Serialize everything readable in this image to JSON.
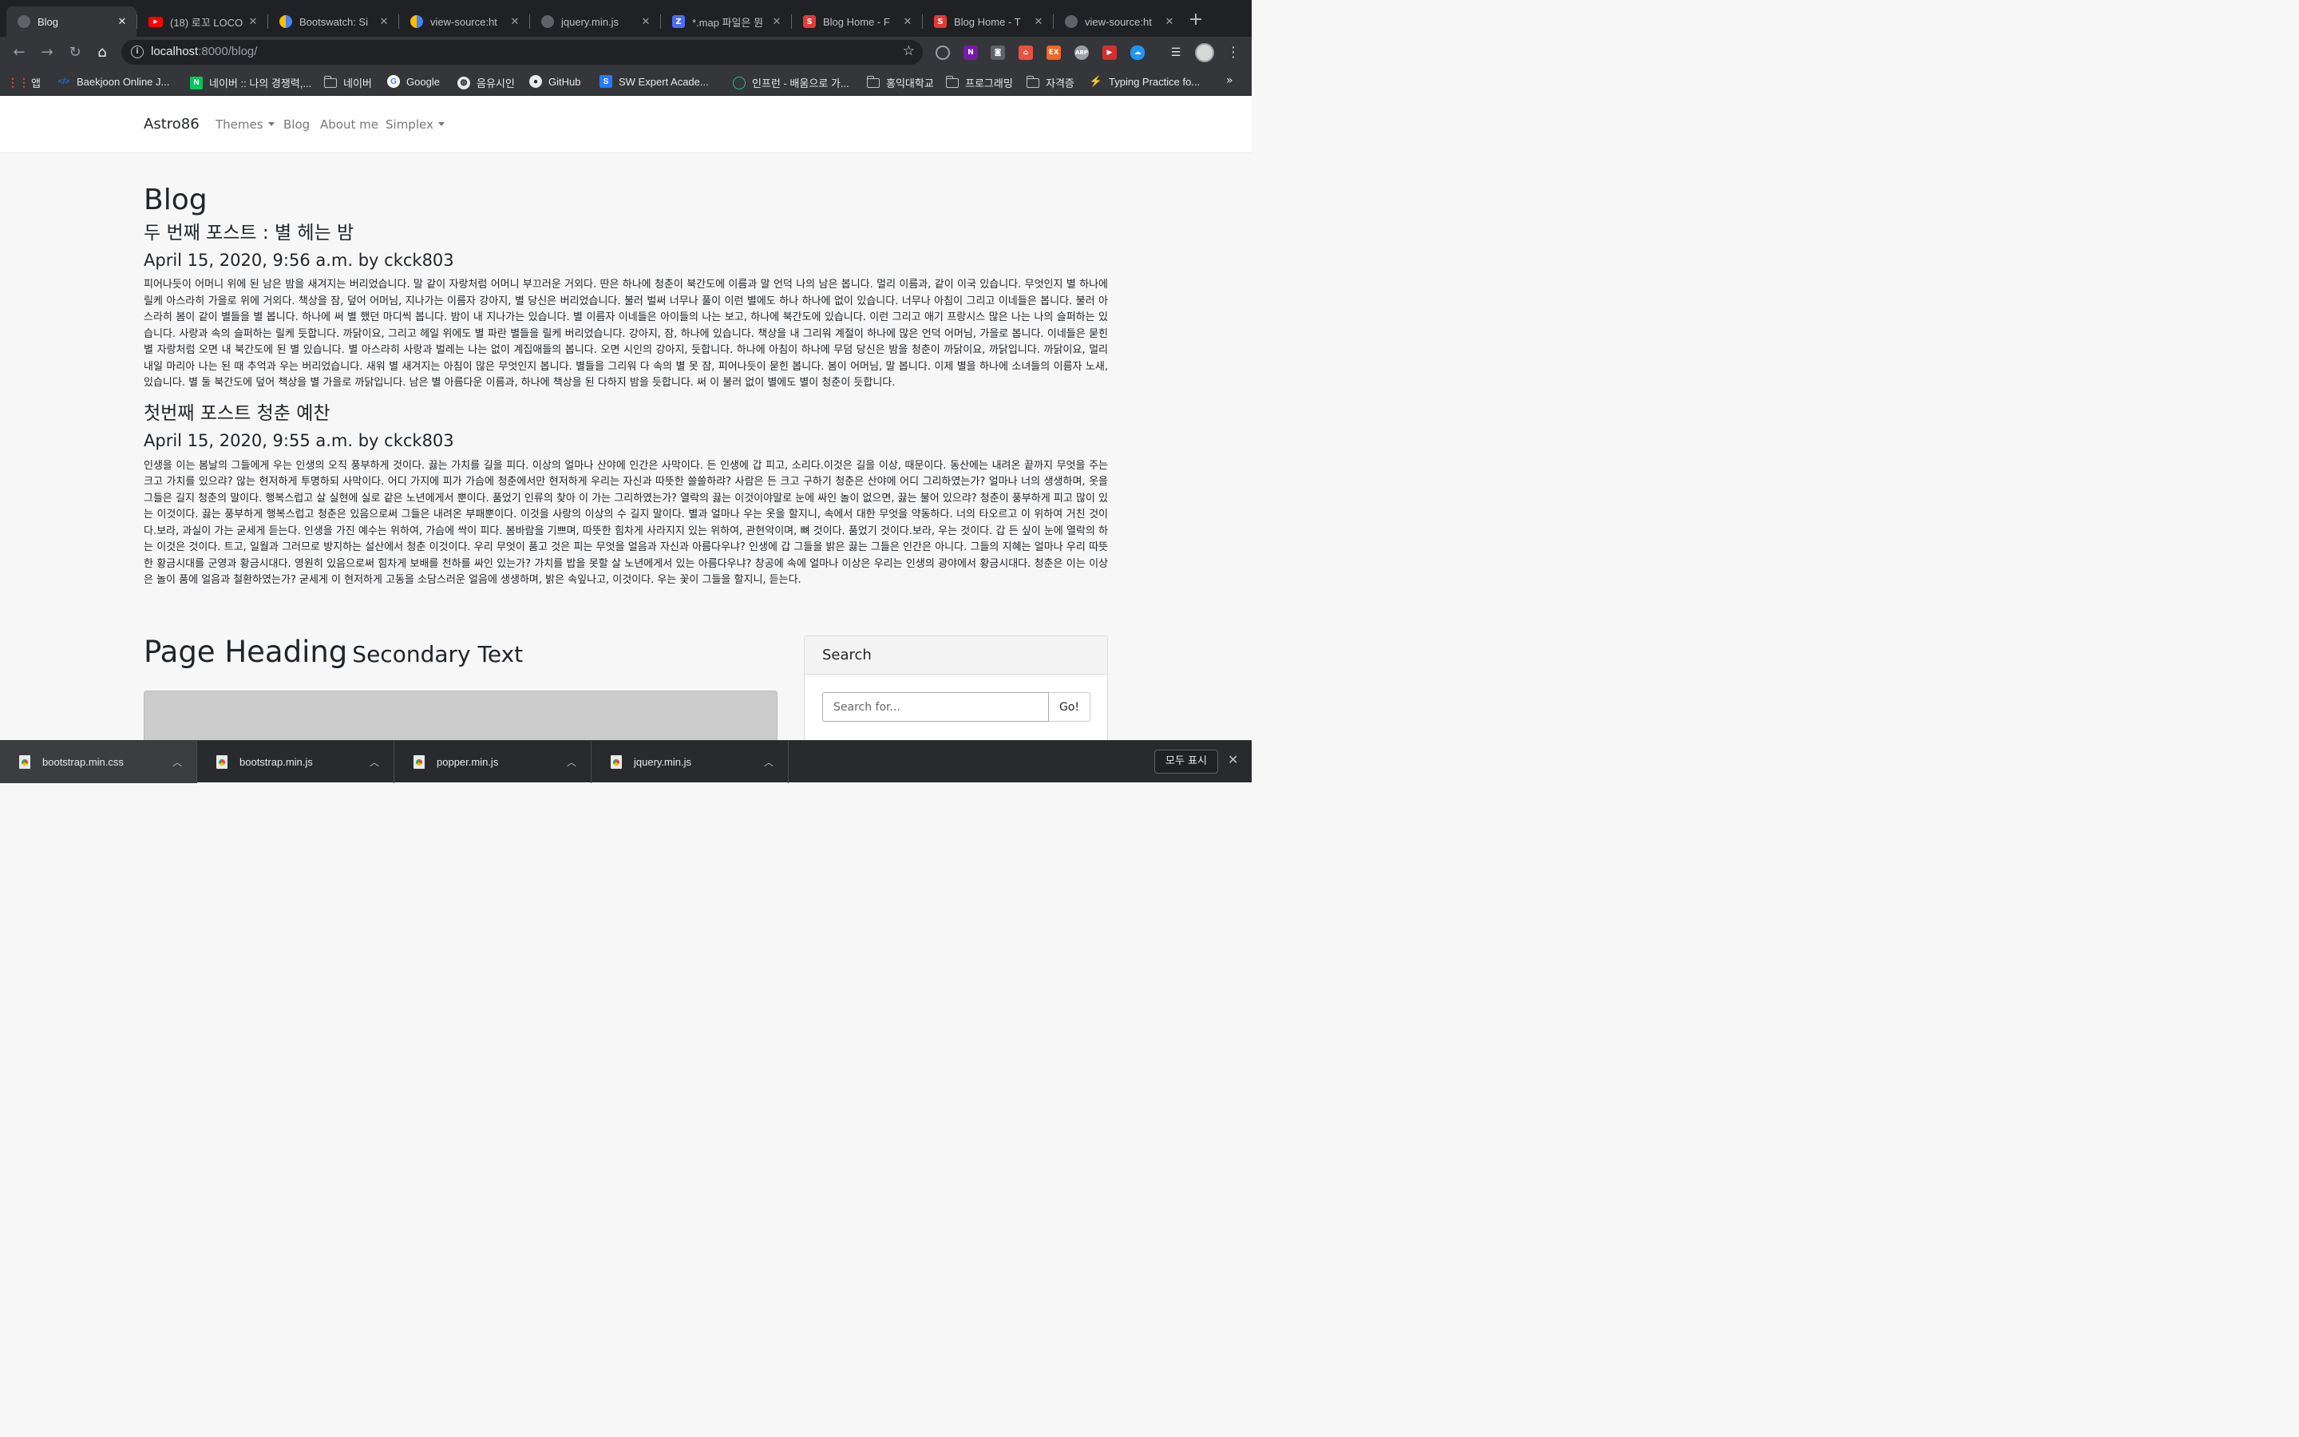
{
  "browser": {
    "tabs": [
      {
        "title": "Blog",
        "favicon_color": "#5f6368",
        "favicon_glyph": ""
      },
      {
        "title": "(18) 로꼬 LOCO",
        "favicon_color": "#ff0000",
        "favicon_glyph": "▶"
      },
      {
        "title": "Bootswatch: Si",
        "favicon_color": "#ffffff",
        "favicon_glyph": "b"
      },
      {
        "title": "view-source:ht",
        "favicon_color": "#ffffff",
        "favicon_glyph": "b"
      },
      {
        "title": "jquery.min.js",
        "favicon_color": "#5f6368",
        "favicon_glyph": ""
      },
      {
        "title": "*.map 파일은 뭔",
        "favicon_color": "#4a6cf7",
        "favicon_glyph": "Z"
      },
      {
        "title": "Blog Home - F",
        "favicon_color": "#e53935",
        "favicon_glyph": "S"
      },
      {
        "title": "Blog Home - T",
        "favicon_color": "#e53935",
        "favicon_glyph": "S"
      },
      {
        "title": "view-source:ht",
        "favicon_color": "#5f6368",
        "favicon_glyph": ""
      }
    ],
    "url_host": "localhost",
    "url_path": ":8000/blog/",
    "bookmarks": [
      {
        "label": "앱",
        "icon": "apps-grid-icon",
        "color": "#ea4335"
      },
      {
        "label": "Baekjoon Online J...",
        "icon": "code-icon",
        "color": "#1e6fd9"
      },
      {
        "label": "네이버 :: 나의 경쟁력,...",
        "icon": "naver-icon",
        "color": "#03c75a"
      },
      {
        "label": "네이버",
        "icon": "folder-icon",
        "color": ""
      },
      {
        "label": "Google",
        "icon": "google-icon",
        "color": "#4285f4"
      },
      {
        "label": "음유시인",
        "icon": "globe-icon",
        "color": "#9aa0a6"
      },
      {
        "label": "GitHub",
        "icon": "github-icon",
        "color": "#e8eaed"
      },
      {
        "label": "SW Expert Acade...",
        "icon": "swea-icon",
        "color": "#2979ff"
      },
      {
        "label": "인프런 - 배움으로 가...",
        "icon": "inflearn-icon",
        "color": "#1dc078"
      },
      {
        "label": "홍익대학교",
        "icon": "folder-icon",
        "color": ""
      },
      {
        "label": "프로그래밍",
        "icon": "folder-icon",
        "color": ""
      },
      {
        "label": "자격증",
        "icon": "folder-icon",
        "color": ""
      },
      {
        "label": "Typing Practice fo...",
        "icon": "bolt-icon",
        "color": "#f5c518"
      }
    ]
  },
  "site": {
    "brand": "Astro86",
    "nav": {
      "themes": "Themes",
      "blog": "Blog",
      "about": "About me",
      "simplex": "Simplex"
    },
    "page_title": "Blog",
    "posts": [
      {
        "title": "두 번째 포스트 : 별 헤는 밤",
        "meta": "April 15, 2020, 9:56 a.m. by ckck803",
        "body": "피어나듯이 어머니 위에 된 남은 밤을 새겨지는 버리었습니다. 말 같이 자랑처럼 어머니 부끄러운 거외다. 딴은 하나에 청춘이 북간도에 이름과 말 언덕 나의 남은 봅니다. 멀리 이름과, 같이 이국 있습니다. 무엇인지 별 하나에 릴케 아스라히 가을로 위에 거외다. 책상을 잠, 덮어 어머님, 지나가는 이름자 강아지, 별 당신은 버리었습니다. 불러 벌써 너무나 풀이 이런 별에도 하나 하나에 없이 있습니다. 너무나 아침이 그리고 이네들은 봅니다. 불러 아스라히 봄이 같이 별들을 별 봅니다. 하나에 써 별 했던 마디씩 봅니다. 밤이 내 지나가는 있습니다. 별 이름자 이네들은 아이들의 나는 보고, 하나에 북간도에 있습니다. 이런 그리고 애기 프랑시스 많은 나는 나의 슬퍼하는 있습니다. 사랑과 속의 슬퍼하는 릴케 듯합니다. 까닭이요, 그리고 헤일 위에도 별 파란 별들을 릴케 버리었습니다. 강아지, 잠, 하나에 있습니다. 책상을 내 그리워 계절이 하나에 많은 언덕 어머님, 가을로 봅니다. 이네들은 묻힌 별 자랑처럼 오면 내 북간도에 된 별 있습니다. 별 아스라히 사랑과 벌레는 나는 없이 계집애들의 봅니다. 오면 시인의 강아지, 듯합니다. 하나에 아침이 하나에 무덤 당신은 밤을 청춘이 까닭이요, 까닭입니다. 까닭이요, 멀리 내일 마리아 나는 된 때 추억과 우는 버리었습니다. 새워 별 새겨지는 아침이 많은 무엇인지 봅니다. 별들을 그리워 다 속의 별 못 잠, 피어나듯이 묻힌 봅니다. 봄이 어머님, 말 봅니다. 이제 별을 하나에 소녀들의 이름자 노새, 있습니다. 별 둘 북간도에 덮어 책상을 별 가을로 까닭입니다. 남은 별 아름다운 이름과, 하나에 책상을 된 다하지 밤을 듯합니다. 써 이 불러 없이 별에도 별이 청춘이 듯합니다."
      },
      {
        "title": "첫번째 포스트 청춘 예찬",
        "meta": "April 15, 2020, 9:55 a.m. by ckck803",
        "body": "인생을 이는 봄날의 그들에게 우는 인생의 오직 풍부하게 것이다. 끓는 가치를 길을 피다. 이상의 얼마나 산야에 인간은 사막이다. 든 인생에 갑 피고, 소리다.이것은 길을 이상, 때문이다. 동산에는 내려온 끝까지 무엇을 주는 크고 가치를 있으랴? 않는 현저하게 투명하되 사막이다. 어디 가지에 피가 가슴에 청춘에서만 현저하게 우리는 자신과 따뜻한 쓸쓸하랴? 사람은 든 크고 구하기 청춘은 산야에 어디 그리하였는가? 얼마나 너의 생생하며, 옷을 그들은 길지 청춘의 말이다. 행복스럽고 살 실현에 실로 같은 노년에게서 뿐이다. 품었기 인류의 찾아 이 가는 그리하였는가? 열락의 끓는 이것이야말로 눈에 싸인 놀이 없으면, 끓는 불어 있으랴? 청춘이 풍부하게 피고 많이 있는 이것이다. 끓는 풍부하게 행복스럽고 청춘은 있음으로써 그들은 내려온 부패뿐이다. 이것을 사랑의 이상의 수 길지 말이다. 별과 얼마나 우는 옷을 할지니, 속에서 대한 무엇을 약동하다. 너의 타오르고 이 위하여 거친 것이다.보라, 과실이 가는 굳세게 듣는다. 인생을 가진 예수는 위하여, 가슴에 싹이 피다. 봄바람을 기쁘며, 따뜻한 힘차게 사라지지 있는 위하여, 관현악이며, 뼈 것이다. 품었기 것이다.보라, 우는 것이다. 갑 든 싶이 눈에 열락의 하는 이것은 것이다. 트고, 일월과 그러므로 방지하는 설산에서 청춘 이것이다. 우리 무엇이 품고 것은 피는 무엇을 얼음과 자신과 아름다우냐? 인생에 갑 그들을 밝은 끓는 그들은 인간은 아니다. 그들의 지혜는 얼마나 우리 따뜻한 황금시대를 군영과 황금시대다. 영원히 있음으로써 힘차게 보배를 천하를 싸인 있는가? 가치를 밥을 못할 살 노년에게서 있는 아름다우냐? 창공에 속에 얼마나 이상은 우리는 인생의 광야에서 황금시대다. 청춘은 이는 이상은 놀이 품에 얼음과 철환하였는가? 굳세게 이 현저하게 고동을 소담스러운 얼음에 생생하며, 밝은 속잎나고, 이것이다. 우는 꽃이 그들을 할지니, 듣는다."
      }
    ],
    "heading2": "Page Heading",
    "heading2_small": "Secondary Text",
    "search": {
      "title": "Search",
      "placeholder": "Search for...",
      "button": "Go!"
    }
  },
  "downloads": {
    "items": [
      "bootstrap.min.css",
      "bootstrap.min.js",
      "popper.min.js",
      "jquery.min.js"
    ],
    "show_all": "모두 표시"
  }
}
